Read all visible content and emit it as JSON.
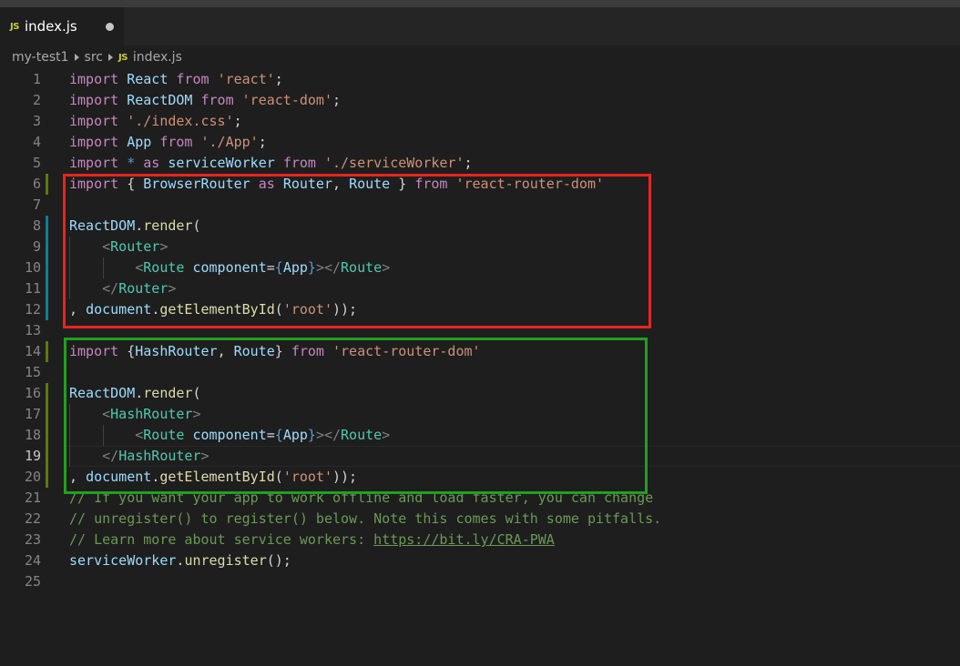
{
  "tab": {
    "label": "index.js",
    "badge": "JS",
    "dirty_icon": "dot-icon"
  },
  "breadcrumb": {
    "items": [
      "my-test1",
      "src",
      "index.js"
    ],
    "badge": "JS"
  },
  "editor": {
    "active_line": 19,
    "lines": [
      {
        "n": "1",
        "tokens": [
          [
            "kw",
            "import"
          ],
          [
            "pun",
            " "
          ],
          [
            "id",
            "React"
          ],
          [
            "pun",
            " "
          ],
          [
            "kw",
            "from"
          ],
          [
            "pun",
            " "
          ],
          [
            "str",
            "'react'"
          ],
          [
            "pun",
            ";"
          ]
        ]
      },
      {
        "n": "2",
        "tokens": [
          [
            "kw",
            "import"
          ],
          [
            "pun",
            " "
          ],
          [
            "id",
            "ReactDOM"
          ],
          [
            "pun",
            " "
          ],
          [
            "kw",
            "from"
          ],
          [
            "pun",
            " "
          ],
          [
            "str",
            "'react-dom'"
          ],
          [
            "pun",
            ";"
          ]
        ]
      },
      {
        "n": "3",
        "tokens": [
          [
            "kw",
            "import"
          ],
          [
            "pun",
            " "
          ],
          [
            "str",
            "'./index.css'"
          ],
          [
            "pun",
            ";"
          ]
        ]
      },
      {
        "n": "4",
        "tokens": [
          [
            "kw",
            "import"
          ],
          [
            "pun",
            " "
          ],
          [
            "id",
            "App"
          ],
          [
            "pun",
            " "
          ],
          [
            "kw",
            "from"
          ],
          [
            "pun",
            " "
          ],
          [
            "str",
            "'./App'"
          ],
          [
            "pun",
            ";"
          ]
        ]
      },
      {
        "n": "5",
        "tokens": [
          [
            "kw",
            "import"
          ],
          [
            "pun",
            " "
          ],
          [
            "bl",
            "*"
          ],
          [
            "pun",
            " "
          ],
          [
            "kw",
            "as"
          ],
          [
            "pun",
            " "
          ],
          [
            "id",
            "serviceWorker"
          ],
          [
            "pun",
            " "
          ],
          [
            "kw",
            "from"
          ],
          [
            "pun",
            " "
          ],
          [
            "str",
            "'./serviceWorker'"
          ],
          [
            "pun",
            ";"
          ]
        ]
      },
      {
        "n": "6",
        "tokens": [
          [
            "kw",
            "import"
          ],
          [
            "pun",
            " { "
          ],
          [
            "id",
            "BrowserRouter"
          ],
          [
            "pun",
            " "
          ],
          [
            "kw",
            "as"
          ],
          [
            "pun",
            " "
          ],
          [
            "id",
            "Router"
          ],
          [
            "pun",
            ", "
          ],
          [
            "id",
            "Route"
          ],
          [
            "pun",
            " } "
          ],
          [
            "kw",
            "from"
          ],
          [
            "pun",
            " "
          ],
          [
            "str",
            "'react-router-dom'"
          ]
        ]
      },
      {
        "n": "7",
        "tokens": []
      },
      {
        "n": "8",
        "tokens": [
          [
            "id",
            "ReactDOM"
          ],
          [
            "pun",
            "."
          ],
          [
            "fn",
            "render"
          ],
          [
            "pun",
            "("
          ]
        ]
      },
      {
        "n": "9",
        "tokens": [
          [
            "pun",
            "    "
          ],
          [
            "ang",
            "<"
          ],
          [
            "tag",
            "Router"
          ],
          [
            "ang",
            ">"
          ]
        ]
      },
      {
        "n": "10",
        "tokens": [
          [
            "pun",
            "        "
          ],
          [
            "ang",
            "<"
          ],
          [
            "tag",
            "Route"
          ],
          [
            "pun",
            " "
          ],
          [
            "attr",
            "component"
          ],
          [
            "pun",
            "="
          ],
          [
            "brace",
            "{"
          ],
          [
            "id",
            "App"
          ],
          [
            "brace",
            "}"
          ],
          [
            "ang",
            "></"
          ],
          [
            "tag",
            "Route"
          ],
          [
            "ang",
            ">"
          ]
        ]
      },
      {
        "n": "11",
        "tokens": [
          [
            "pun",
            "    "
          ],
          [
            "ang",
            "</"
          ],
          [
            "tag",
            "Router"
          ],
          [
            "ang",
            ">"
          ]
        ]
      },
      {
        "n": "12",
        "tokens": [
          [
            "pun",
            ", "
          ],
          [
            "id",
            "document"
          ],
          [
            "pun",
            "."
          ],
          [
            "fn",
            "getElementById"
          ],
          [
            "pun",
            "("
          ],
          [
            "str",
            "'root'"
          ],
          [
            "pun",
            "));"
          ]
        ]
      },
      {
        "n": "13",
        "tokens": []
      },
      {
        "n": "14",
        "tokens": [
          [
            "kw",
            "import"
          ],
          [
            "pun",
            " {"
          ],
          [
            "id",
            "HashRouter"
          ],
          [
            "pun",
            ", "
          ],
          [
            "id",
            "Route"
          ],
          [
            "pun",
            "} "
          ],
          [
            "kw",
            "from"
          ],
          [
            "pun",
            " "
          ],
          [
            "str",
            "'react-router-dom'"
          ]
        ]
      },
      {
        "n": "15",
        "tokens": []
      },
      {
        "n": "16",
        "tokens": [
          [
            "id",
            "ReactDOM"
          ],
          [
            "pun",
            "."
          ],
          [
            "fn",
            "render"
          ],
          [
            "pun",
            "("
          ]
        ]
      },
      {
        "n": "17",
        "tokens": [
          [
            "pun",
            "    "
          ],
          [
            "ang",
            "<"
          ],
          [
            "tag",
            "HashRouter"
          ],
          [
            "ang",
            ">"
          ]
        ]
      },
      {
        "n": "18",
        "tokens": [
          [
            "pun",
            "        "
          ],
          [
            "ang",
            "<"
          ],
          [
            "tag",
            "Route"
          ],
          [
            "pun",
            " "
          ],
          [
            "attr",
            "component"
          ],
          [
            "pun",
            "="
          ],
          [
            "brace",
            "{"
          ],
          [
            "id",
            "App"
          ],
          [
            "brace",
            "}"
          ],
          [
            "ang",
            "></"
          ],
          [
            "tag",
            "Route"
          ],
          [
            "ang",
            ">"
          ]
        ]
      },
      {
        "n": "19",
        "tokens": [
          [
            "pun",
            "    "
          ],
          [
            "ang",
            "</"
          ],
          [
            "tag",
            "HashRouter"
          ],
          [
            "ang",
            ">"
          ]
        ]
      },
      {
        "n": "20",
        "tokens": [
          [
            "pun",
            ", "
          ],
          [
            "id",
            "document"
          ],
          [
            "pun",
            "."
          ],
          [
            "fn",
            "getElementById"
          ],
          [
            "pun",
            "("
          ],
          [
            "str",
            "'root'"
          ],
          [
            "pun",
            "));"
          ]
        ]
      },
      {
        "n": "21",
        "tokens": [
          [
            "cmt",
            "// If you want your app to work offline and load faster, you can change"
          ]
        ]
      },
      {
        "n": "22",
        "tokens": [
          [
            "cmt",
            "// unregister() to register() below. Note this comes with some pitfalls."
          ]
        ]
      },
      {
        "n": "23",
        "tokens": [
          [
            "cmt",
            "// Learn more about service workers: "
          ],
          [
            "link",
            "https://bit.ly/CRA-PWA"
          ]
        ]
      },
      {
        "n": "24",
        "tokens": [
          [
            "id",
            "serviceWorker"
          ],
          [
            "pun",
            "."
          ],
          [
            "fn",
            "unregister"
          ],
          [
            "pun",
            "();"
          ]
        ]
      },
      {
        "n": "25",
        "tokens": []
      }
    ],
    "gutter_marks": {
      "6": "green",
      "8": "blue",
      "9": "blue",
      "10": "blue",
      "11": "blue",
      "12": "blue",
      "14": "green",
      "16": "green",
      "17": "green",
      "18": "green",
      "19": "green",
      "20": "green"
    },
    "indent_guides": {
      "9": [
        1
      ],
      "10": [
        1,
        2
      ],
      "11": [
        1
      ],
      "17": [
        1
      ],
      "18": [
        1,
        2
      ],
      "19": [
        1
      ]
    }
  },
  "annotations": {
    "red_box_color": "#e8261e",
    "green_box_color": "#20a020"
  }
}
